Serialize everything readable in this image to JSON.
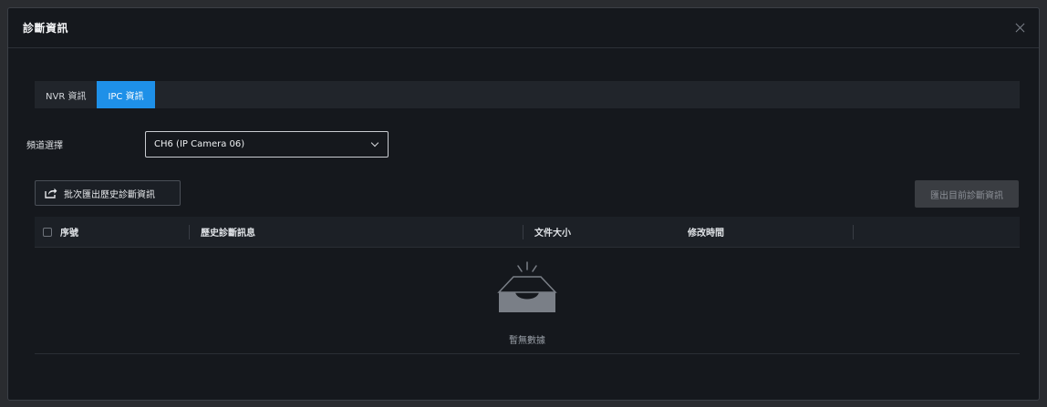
{
  "dialog": {
    "title": "診斷資訊"
  },
  "tabs": [
    {
      "label": "NVR 資訊",
      "active": false
    },
    {
      "label": "IPC 資訊",
      "active": true
    }
  ],
  "channel": {
    "label": "頻道選擇",
    "value": "CH6 (IP Camera 06)"
  },
  "toolbar": {
    "batch_export_label": "批次匯出歷史診斷資訊",
    "export_current_label": "匯出目前診斷資訊"
  },
  "table": {
    "columns": [
      "序號",
      "歷史診斷訊息",
      "文件大小",
      "修改時間"
    ],
    "rows": [],
    "empty_text": "暫無數據"
  },
  "colors": {
    "accent": "#1e90e8",
    "background": "#15181d"
  },
  "icons": {
    "close": "close-icon",
    "export": "share-export-icon",
    "dropdown": "chevron-down-icon",
    "empty": "empty-inbox-icon"
  }
}
